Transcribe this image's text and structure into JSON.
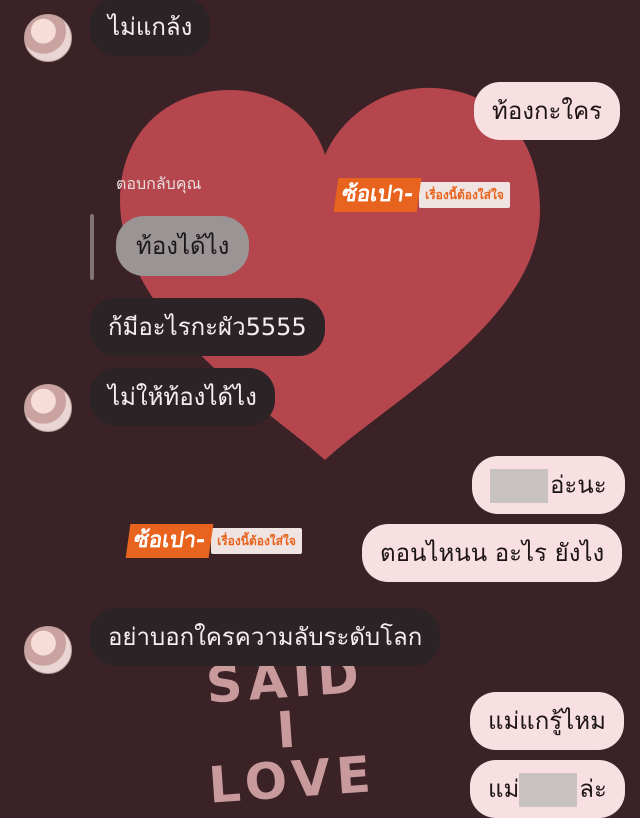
{
  "bg": {
    "line1": "SAID",
    "line2": "I",
    "line3": "LOVE"
  },
  "watermark": {
    "brand": "ซ้อเปา-",
    "tagline": "เรื่องนี้ต้องใส่ใจ"
  },
  "messages": {
    "m1": "ไม่แกล้ง",
    "m2": "ท้องกะใคร",
    "reply_label": "ตอบกลับคุณ",
    "reply_quote": "ท้องได้ไง",
    "m3": "ก้มีอะไรกะผัว5555",
    "m4": "ไม่ให้ท้องได้ไง",
    "m5_suffix": "อ่ะนะ",
    "m6": "ตอนไหนน อะไร ยังไง",
    "m7": "อย่าบอกใครความลับระดับโลก",
    "m8": "แม่แกรู้ไหม",
    "m9_prefix": "แม่",
    "m9_suffix": "ล่ะ"
  },
  "colors": {
    "background": "#3a2226",
    "heart": "#b5464d",
    "incoming_bubble": "#2b2326",
    "outgoing_bubble": "#f7dfe2",
    "brand_orange": "#e8641e"
  }
}
